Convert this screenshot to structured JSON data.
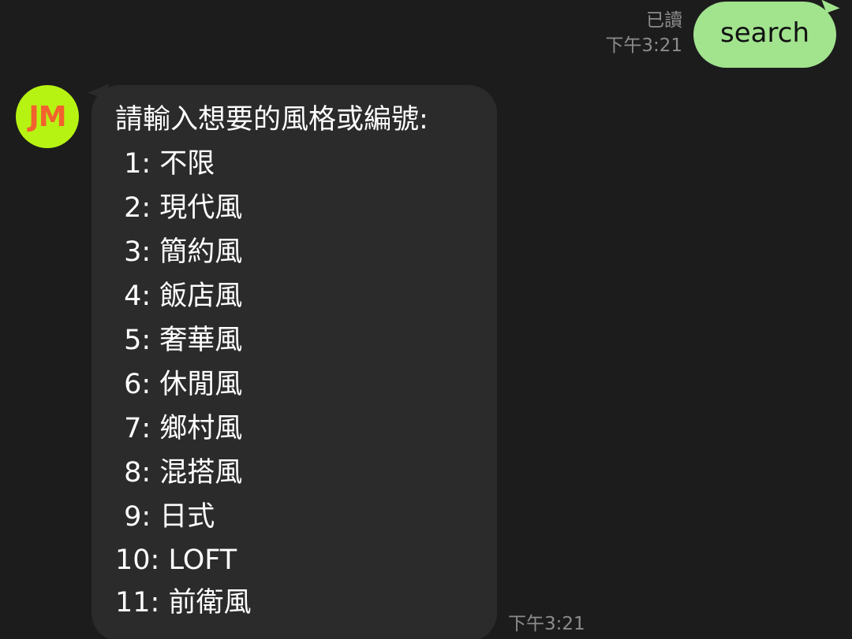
{
  "outgoing": {
    "read_label": "已讀",
    "time": "下午3:21",
    "text": "search"
  },
  "incoming": {
    "avatar_text": "JM",
    "time": "下午3:21",
    "lines": [
      "請輸入想要的風格或編號:",
      " 1: 不限",
      " 2: 現代風",
      " 3: 簡約風",
      " 4: 飯店風",
      " 5: 奢華風",
      " 6: 休閒風",
      " 7: 鄉村風",
      " 8: 混搭風",
      " 9: 日式",
      "10: LOFT",
      "11: 前衛風"
    ]
  },
  "colors": {
    "background": "#1c1c1c",
    "outgoing_bubble": "#a2e38e",
    "incoming_bubble": "#2b2b2b",
    "avatar_bg": "#b7f312",
    "avatar_text": "#f2622e",
    "meta_text": "#8c8c8c"
  }
}
